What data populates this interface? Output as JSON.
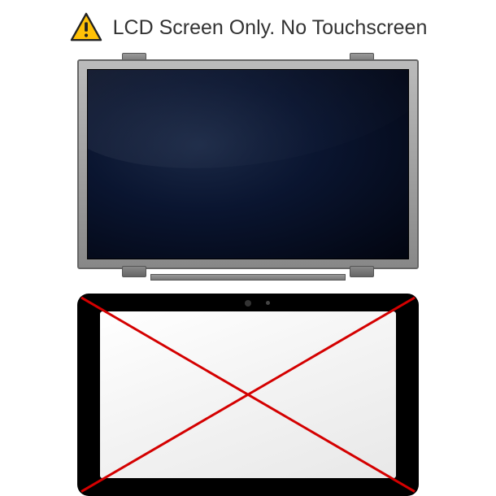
{
  "header": {
    "warning_icon": "warning-triangle",
    "text": "LCD Screen Only. No Touchscreen"
  },
  "colors": {
    "warning_yellow": "#ffc107",
    "warning_border": "#222",
    "cross_red": "#d40000"
  }
}
